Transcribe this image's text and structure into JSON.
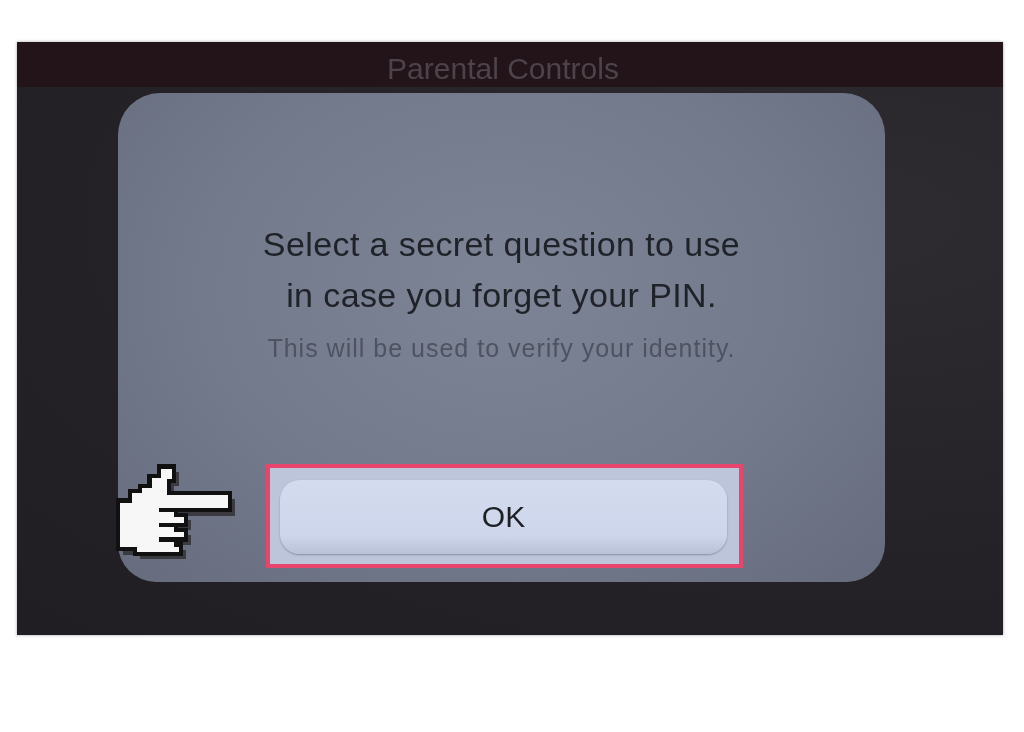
{
  "screen": {
    "title": "Parental Controls"
  },
  "dialog": {
    "message": "Select a secret question to use in case you forget your PIN.",
    "note": "This will be used to verify your identity."
  },
  "buttons": [
    {
      "label": "OK",
      "selected": true
    }
  ]
}
